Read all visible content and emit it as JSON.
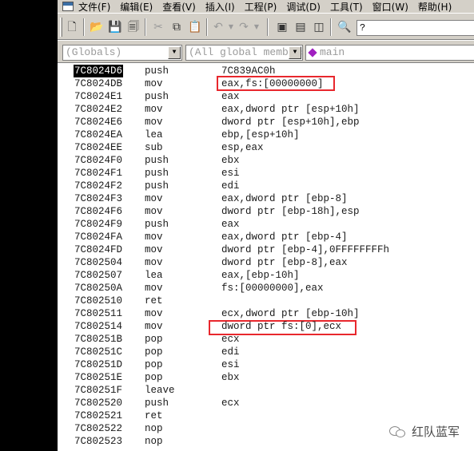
{
  "menu": [
    "文件(F)",
    "编辑(E)",
    "查看(V)",
    "插入(I)",
    "工程(P)",
    "调试(D)",
    "工具(T)",
    "窗口(W)",
    "帮助(H)"
  ],
  "toolbar": {
    "find_value": "?"
  },
  "wizard": {
    "class_combo": "(Globals)",
    "members_combo": "(All global members",
    "function_combo": "main"
  },
  "disasm": [
    {
      "addr": "7C8024D6",
      "op": "push",
      "args": "7C839AC0h",
      "selected": true
    },
    {
      "addr": "7C8024DB",
      "op": "mov",
      "args": "eax,fs:[00000000]"
    },
    {
      "addr": "7C8024E1",
      "op": "push",
      "args": "eax"
    },
    {
      "addr": "7C8024E2",
      "op": "mov",
      "args": "eax,dword ptr [esp+10h]"
    },
    {
      "addr": "7C8024E6",
      "op": "mov",
      "args": "dword ptr [esp+10h],ebp"
    },
    {
      "addr": "7C8024EA",
      "op": "lea",
      "args": "ebp,[esp+10h]"
    },
    {
      "addr": "7C8024EE",
      "op": "sub",
      "args": "esp,eax"
    },
    {
      "addr": "7C8024F0",
      "op": "push",
      "args": "ebx"
    },
    {
      "addr": "7C8024F1",
      "op": "push",
      "args": "esi"
    },
    {
      "addr": "7C8024F2",
      "op": "push",
      "args": "edi"
    },
    {
      "addr": "7C8024F3",
      "op": "mov",
      "args": "eax,dword ptr [ebp-8]"
    },
    {
      "addr": "7C8024F6",
      "op": "mov",
      "args": "dword ptr [ebp-18h],esp"
    },
    {
      "addr": "7C8024F9",
      "op": "push",
      "args": "eax"
    },
    {
      "addr": "7C8024FA",
      "op": "mov",
      "args": "eax,dword ptr [ebp-4]"
    },
    {
      "addr": "7C8024FD",
      "op": "mov",
      "args": "dword ptr [ebp-4],0FFFFFFFFh"
    },
    {
      "addr": "7C802504",
      "op": "mov",
      "args": "dword ptr [ebp-8],eax"
    },
    {
      "addr": "7C802507",
      "op": "lea",
      "args": "eax,[ebp-10h]"
    },
    {
      "addr": "7C80250A",
      "op": "mov",
      "args": "fs:[00000000],eax"
    },
    {
      "addr": "7C802510",
      "op": "ret",
      "args": ""
    },
    {
      "addr": "7C802511",
      "op": "mov",
      "args": "ecx,dword ptr [ebp-10h]"
    },
    {
      "addr": "7C802514",
      "op": "mov",
      "args": "dword ptr fs:[0],ecx"
    },
    {
      "addr": "7C80251B",
      "op": "pop",
      "args": "ecx"
    },
    {
      "addr": "7C80251C",
      "op": "pop",
      "args": "edi"
    },
    {
      "addr": "7C80251D",
      "op": "pop",
      "args": "esi"
    },
    {
      "addr": "7C80251E",
      "op": "pop",
      "args": "ebx"
    },
    {
      "addr": "7C80251F",
      "op": "leave",
      "args": ""
    },
    {
      "addr": "7C802520",
      "op": "push",
      "args": "ecx"
    },
    {
      "addr": "7C802521",
      "op": "ret",
      "args": ""
    },
    {
      "addr": "7C802522",
      "op": "nop",
      "args": ""
    },
    {
      "addr": "7C802523",
      "op": "nop",
      "args": ""
    }
  ],
  "highlight_color": "#e8272d",
  "watermark": "红队蓝军"
}
